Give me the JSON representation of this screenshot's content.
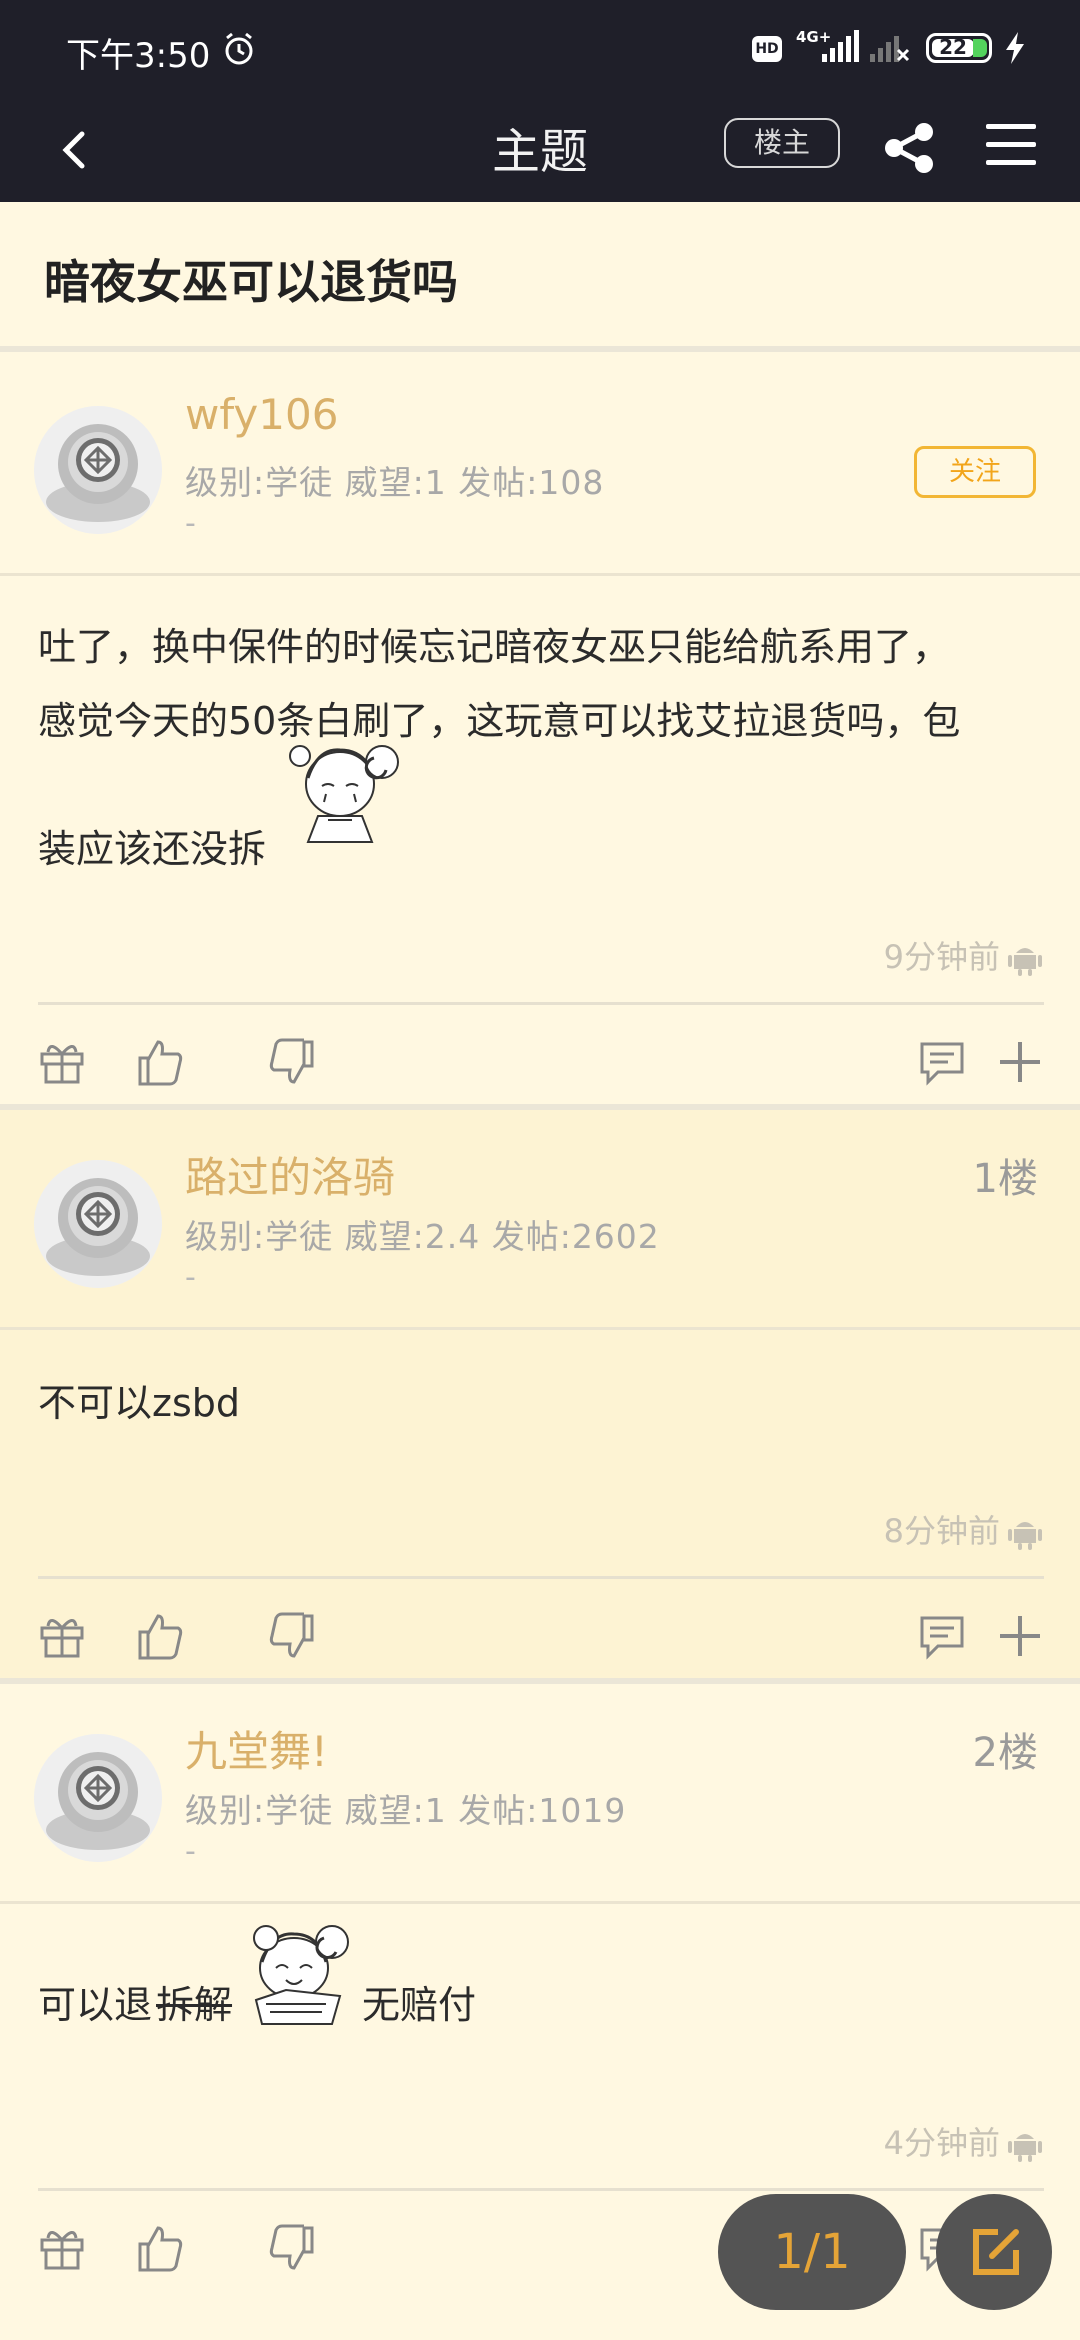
{
  "status_bar": {
    "time": "下午3:50",
    "hd": "HD",
    "network": "4G+",
    "battery": "22"
  },
  "nav": {
    "title": "主题",
    "op_label": "楼主"
  },
  "thread": {
    "title": "暗夜女巫可以退货吗"
  },
  "posts": [
    {
      "username": "wfy106",
      "meta": "级别:学徒 威望:1 发帖:108",
      "sig": "-",
      "follow_label": "关注",
      "content_line1": "吐了，换中保件的时候忘记暗夜女巫只能给航系用了，",
      "content_line2": "感觉今天的50条白刷了，这玩意可以找艾拉退货吗，包",
      "content_line3": "装应该还没拆",
      "time": "9分钟前"
    },
    {
      "username": "路过的洛骑",
      "floor": "1楼",
      "meta": "级别:学徒 威望:2.4 发帖:2602",
      "sig": "-",
      "content": "不可以zsbd",
      "time": "8分钟前"
    },
    {
      "username": "九堂舞!",
      "floor": "2楼",
      "meta": "级别:学徒 威望:1 发帖:1019",
      "sig": "-",
      "content_a": "可以退",
      "content_strike": "拆解",
      "content_b": "无赔付",
      "time": "4分钟前"
    }
  ],
  "pager": "1/1",
  "colors": {
    "topbar": "#1f1f29",
    "background": "#fff8e1",
    "highlight": "#fdf3d3",
    "username": "#d9b06a",
    "follow": "#f2a51a"
  }
}
